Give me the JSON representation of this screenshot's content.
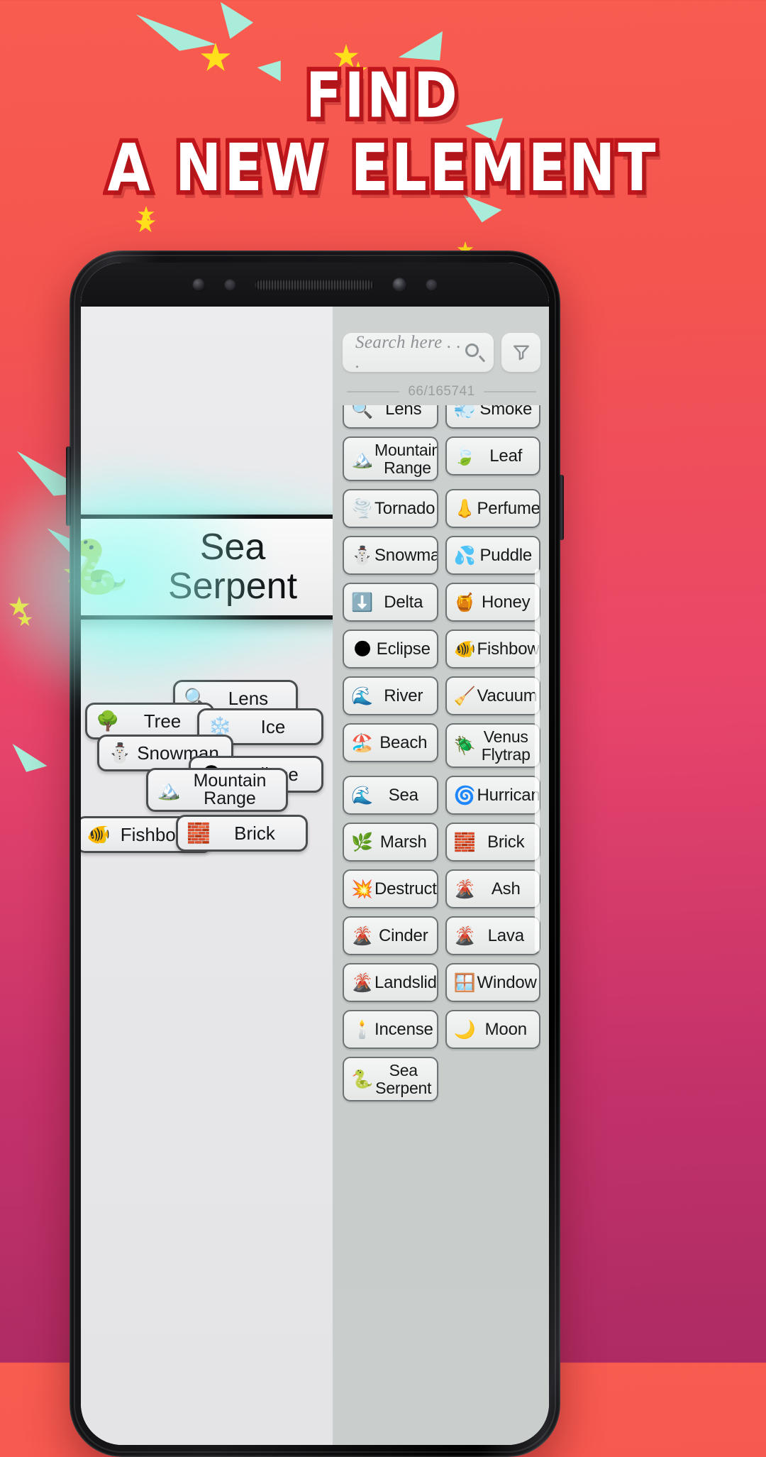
{
  "headline": {
    "line1": "FIND",
    "line2": "A NEW ELEMENT",
    "text_color": "#ffffff",
    "outline_color": "#c0161b"
  },
  "background": {
    "gradient_top": "#f85c4f",
    "gradient_bottom": "#ad2b63",
    "confetti_star_color": "#ffe01b",
    "confetti_shard_color": "#a8ecd9"
  },
  "phone": {
    "frame_color": "#17171a",
    "notch_icons": [
      "front-camera",
      "proximity-sensor",
      "earpiece-speaker",
      "front-camera",
      "light-sensor"
    ]
  },
  "app": {
    "search": {
      "placeholder": "Search here . . .",
      "value": "",
      "icon": "search-icon"
    },
    "filter_button": {
      "icon": "filter-funnel-icon",
      "label": ""
    },
    "counter": "66/165741",
    "result_card": {
      "emoji": "🐍",
      "name": "Sea Serpent",
      "glow_color": "#8cfff0"
    },
    "workspace_cards": [
      {
        "emoji": "🔍",
        "name": "Lens",
        "two_line": false
      },
      {
        "emoji": "🌳",
        "name": "Tree",
        "two_line": false
      },
      {
        "emoji": "❄️",
        "name": "Ice",
        "two_line": false
      },
      {
        "emoji": "⛄",
        "name": "Snowman",
        "two_line": false
      },
      {
        "emoji": "🌑",
        "name": "Eclipse",
        "two_line": false
      },
      {
        "emoji": "🏔️",
        "name": "Mountain Range",
        "two_line": true
      },
      {
        "emoji": "🐠",
        "name": "Fishbowl",
        "two_line": false
      },
      {
        "emoji": "🧱",
        "name": "Brick",
        "two_line": false
      }
    ],
    "element_list": [
      {
        "emoji": "🔍",
        "name": "Lens",
        "two_line": false
      },
      {
        "emoji": "💨",
        "name": "Smoke",
        "two_line": false
      },
      {
        "emoji": "🏔️",
        "name": "Mountain Range",
        "two_line": true
      },
      {
        "emoji": "🍃",
        "name": "Leaf",
        "two_line": false
      },
      {
        "emoji": "🌪️",
        "name": "Tornado",
        "two_line": false
      },
      {
        "emoji": "👃",
        "name": "Perfume",
        "two_line": false
      },
      {
        "emoji": "⛄",
        "name": "Snowman",
        "two_line": false
      },
      {
        "emoji": "💦",
        "name": "Puddle",
        "two_line": false
      },
      {
        "emoji": "⬇️",
        "name": "Delta",
        "two_line": false
      },
      {
        "emoji": "🍯",
        "name": "Honey",
        "two_line": false
      },
      {
        "emoji": "🌑",
        "name": "Eclipse",
        "two_line": false
      },
      {
        "emoji": "🐠",
        "name": "Fishbowl",
        "two_line": false
      },
      {
        "emoji": "🌊",
        "name": "River",
        "two_line": false
      },
      {
        "emoji": "🧹",
        "name": "Vacuum",
        "two_line": false
      },
      {
        "emoji": "🏖️",
        "name": "Beach",
        "two_line": false
      },
      {
        "emoji": "🪲",
        "name": "Venus Flytrap",
        "two_line": true
      },
      {
        "emoji": "🌊",
        "name": "Sea",
        "two_line": false
      },
      {
        "emoji": "🌀",
        "name": "Hurricane",
        "two_line": false
      },
      {
        "emoji": "🌿",
        "name": "Marsh",
        "two_line": false
      },
      {
        "emoji": "🧱",
        "name": "Brick",
        "two_line": false
      },
      {
        "emoji": "💥",
        "name": "Destruction",
        "two_line": false
      },
      {
        "emoji": "🌋",
        "name": "Ash",
        "two_line": false
      },
      {
        "emoji": "🌋",
        "name": "Cinder",
        "two_line": false
      },
      {
        "emoji": "🌋",
        "name": "Lava",
        "two_line": false
      },
      {
        "emoji": "🌋",
        "name": "Landslide",
        "two_line": false
      },
      {
        "emoji": "🪟",
        "name": "Window",
        "two_line": false
      },
      {
        "emoji": "🕯️",
        "name": "Incense",
        "two_line": false
      },
      {
        "emoji": "🌙",
        "name": "Moon",
        "two_line": false
      },
      {
        "emoji": "🐍",
        "name": "Sea Serpent",
        "two_line": true
      }
    ]
  }
}
